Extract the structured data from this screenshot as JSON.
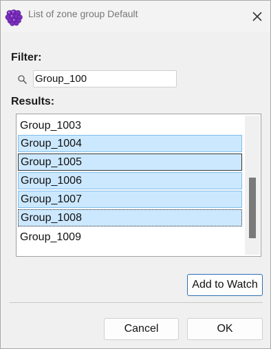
{
  "window": {
    "title": "List of zone group Default"
  },
  "filter": {
    "label": "Filter:",
    "value": "Group_100"
  },
  "results": {
    "label": "Results:",
    "items": [
      "Group_1003",
      "Group_1004",
      "Group_1005",
      "Group_1006",
      "Group_1007",
      "Group_1008",
      "Group_1009"
    ],
    "selected": [
      "Group_1004",
      "Group_1005",
      "Group_1006",
      "Group_1007",
      "Group_1008"
    ]
  },
  "buttons": {
    "add_to_watch": "Add to Watch",
    "cancel": "Cancel",
    "ok": "OK"
  },
  "colors": {
    "selection": "#cce8ff",
    "accent": "#2c6fb0",
    "app_icon": "#7b2fbf"
  },
  "icons": {
    "app": "grape-cluster-icon",
    "close": "close-icon",
    "search": "search-icon"
  }
}
